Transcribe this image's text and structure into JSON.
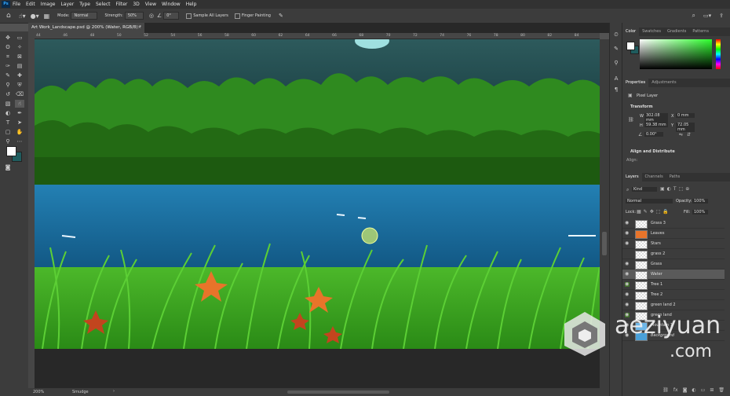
{
  "menubar": {
    "app_icon": "Ps",
    "items": [
      "File",
      "Edit",
      "Image",
      "Layer",
      "Type",
      "Select",
      "Filter",
      "3D",
      "View",
      "Window",
      "Help"
    ]
  },
  "options": {
    "mode_label": "Mode:",
    "mode_value": "Normal",
    "strength_label": "Strength:",
    "strength_value": "50%",
    "angle_value": "0°",
    "sample_all_layers": "Sample All Layers",
    "finger_painting": "Finger Painting"
  },
  "document": {
    "tab_title": "Art Work_Landscape.psd @ 200% (Water, RGB/8) *",
    "ruler_numbers": [
      "44",
      "46",
      "48",
      "50",
      "52",
      "54",
      "56",
      "58",
      "60",
      "62",
      "64",
      "66",
      "68",
      "70",
      "72",
      "74",
      "76",
      "78",
      "80",
      "82",
      "84"
    ]
  },
  "status": {
    "zoom": "200%",
    "tool_name": "Smudge"
  },
  "color_panel": {
    "tabs": [
      "Color",
      "Swatches",
      "Gradients",
      "Patterns"
    ],
    "fg_color": "#ffffff",
    "bg_color": "#1f5c5e"
  },
  "properties_panel": {
    "tabs": [
      "Properties",
      "Adjustments"
    ],
    "layer_kind": "Pixel Layer",
    "transform_label": "Transform",
    "w_label": "W",
    "w_value": "302.08 mm",
    "h_label": "H",
    "h_value": "59.38 mm",
    "x_label": "X",
    "x_value": "0 mm",
    "y_label": "Y",
    "y_value": "72.05 mm",
    "angle_value": "0.00°",
    "align_label": "Align and Distribute",
    "align_sub": "Align:"
  },
  "layers_panel": {
    "tabs": [
      "Layers",
      "Channels",
      "Paths"
    ],
    "kind_label": "Kind",
    "blend_mode": "Normal",
    "opacity_label": "Opacity:",
    "opacity_value": "100%",
    "lock_label": "Lock:",
    "fill_label": "Fill:",
    "fill_value": "100%",
    "layers": [
      {
        "name": "Grass 3",
        "visible": true
      },
      {
        "name": "Leaves",
        "visible": true
      },
      {
        "name": "Stars",
        "visible": true
      },
      {
        "name": "grass 2",
        "visible": false
      },
      {
        "name": "Grass",
        "visible": true
      },
      {
        "name": "Water",
        "visible": true,
        "selected": true
      },
      {
        "name": "Tree 1",
        "visible": true
      },
      {
        "name": "Tree 2",
        "visible": true
      },
      {
        "name": "green land 2",
        "visible": true
      },
      {
        "name": "green land",
        "visible": true
      },
      {
        "name": "Mountain 1",
        "visible": true
      },
      {
        "name": "Background",
        "visible": true
      }
    ]
  },
  "watermark": {
    "text": "aeziyuan",
    "subtext": ".com"
  },
  "colors": {
    "sky": "#1e4a50",
    "trees": "#2f8a1f",
    "water": "#1a6fa0",
    "grass": "#3aa51e",
    "leaf": "#e8742a"
  }
}
